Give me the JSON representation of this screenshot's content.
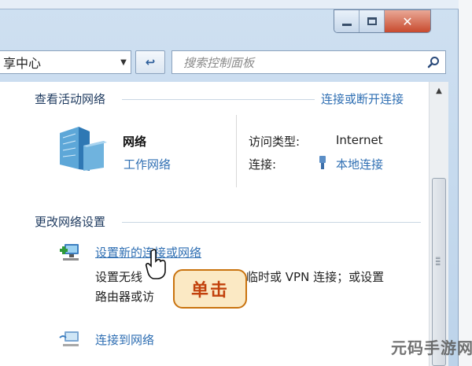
{
  "window": {
    "caption_buttons": [
      "minimize",
      "maximize",
      "close"
    ],
    "close_symbol": "✕"
  },
  "toolbar": {
    "address_text": "享中心",
    "address_dropdown_icon": "chevron-down-icon",
    "refresh_symbol": "↩",
    "search_placeholder": "搜索控制面板"
  },
  "active_networks": {
    "section_title": "查看活动网络",
    "connect_disconnect_link": "连接或断开连接",
    "network_name": "网络",
    "network_type": "工作网络",
    "access_type_label": "访问类型:",
    "access_type_value": "Internet",
    "connections_label": "连接:",
    "connections_value": "本地连接"
  },
  "change_settings": {
    "section_title": "更改网络设置",
    "tasks": [
      {
        "link": "设置新的连接或网络",
        "desc_line1_left": "设置无线",
        "desc_line1_right": "临时或 VPN 连接；或设置",
        "desc_line2": "路由器或访"
      },
      {
        "link": "连接到网络"
      }
    ]
  },
  "overlay": {
    "callout_text": "单击"
  },
  "watermark": "元码手游网",
  "colors": {
    "link": "#2f6fb3",
    "callout_border": "#c9730f",
    "callout_fill": "#fbe9c4"
  }
}
